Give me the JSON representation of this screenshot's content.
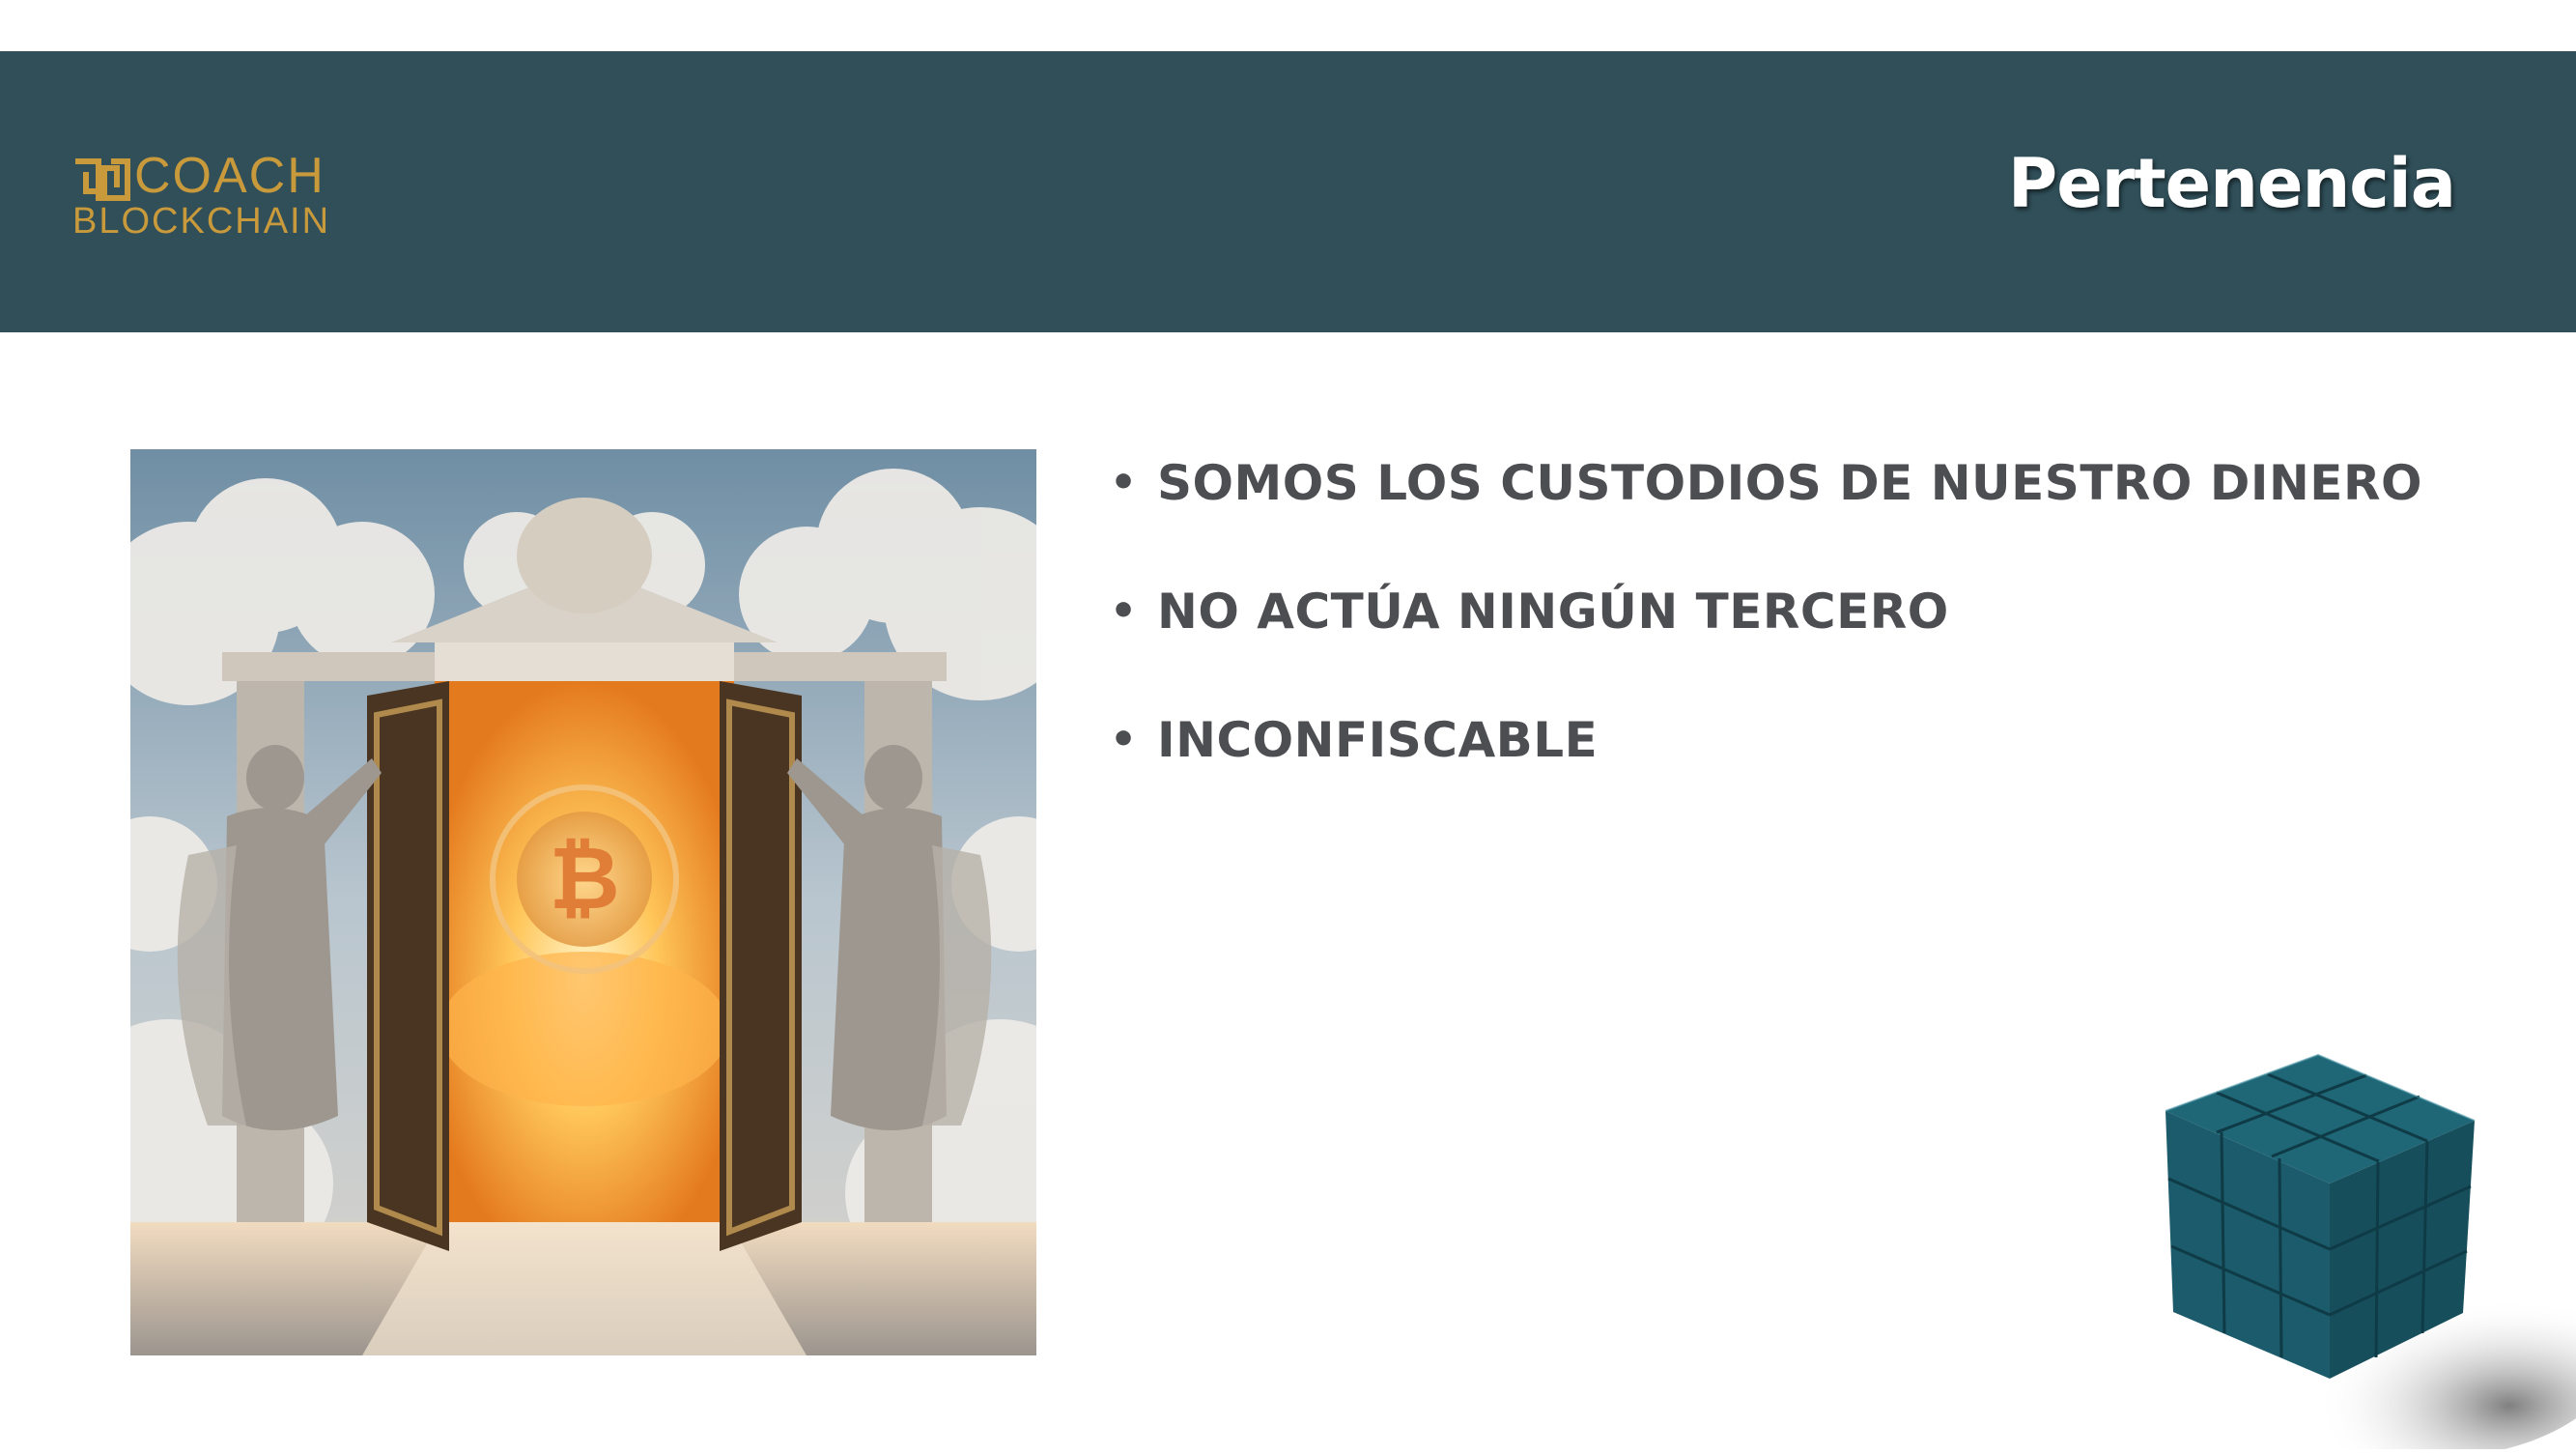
{
  "colors": {
    "header_band": "#304f59",
    "logo_gold": "#c99a3b",
    "bullet_text": "#4d4e52",
    "cube": "#1b5b6b"
  },
  "logo": {
    "line1": "COACH",
    "line2": "BLOCKCHAIN",
    "mark_icon": "coach-blockchain-mark-icon"
  },
  "title": "Pertenencia",
  "bullets": [
    "SOMOS LOS CUSTODIOS DE NUESTRO DINERO",
    "NO ACTÚA NINGÚN TERCERO",
    "INCONFISCABLE"
  ],
  "bullet_glyph": "•",
  "images": {
    "photo": "heaven-gate-bitcoin-illustration",
    "decor": "teal-cube-graphic"
  }
}
